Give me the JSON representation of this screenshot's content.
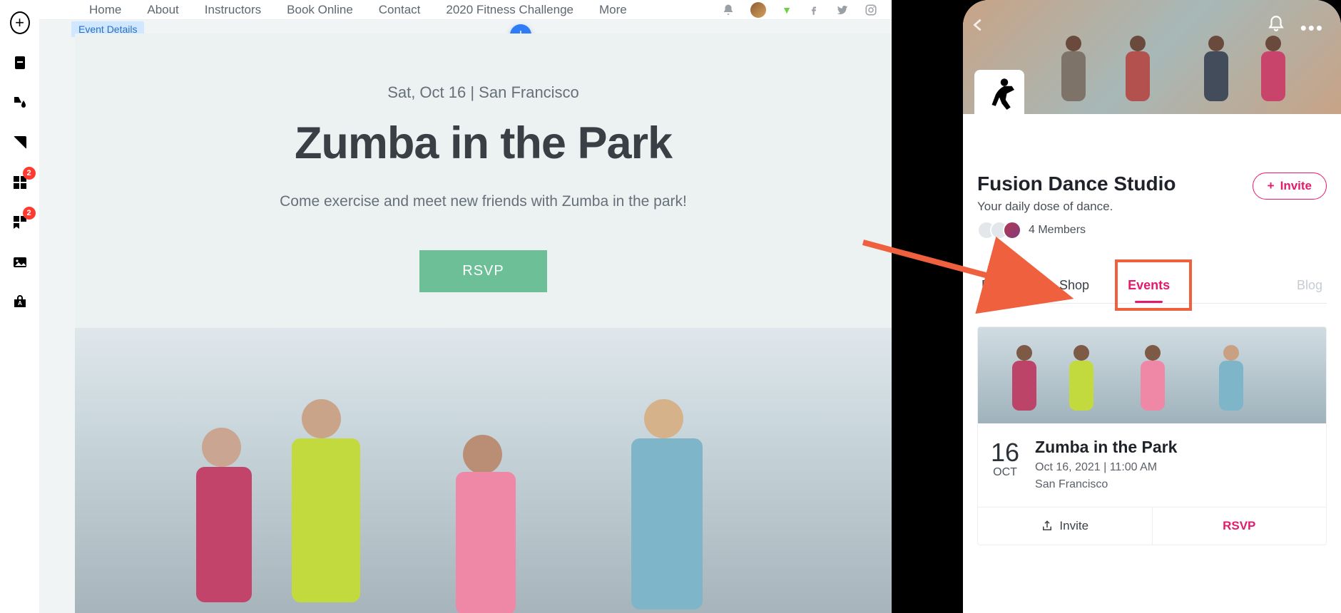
{
  "toolbar": {
    "badges": {
      "elements": "2",
      "sections": "2"
    }
  },
  "nav": {
    "items": [
      "Home",
      "About",
      "Instructors",
      "Book Online",
      "Contact",
      "2020 Fitness Challenge",
      "More"
    ]
  },
  "strip": {
    "label": "Event Details"
  },
  "event": {
    "dateloc": "Sat, Oct 16   |   San Francisco",
    "title": "Zumba in the Park",
    "subtitle": "Come exercise and meet new friends with Zumba in the park!",
    "rsvp": "RSVP"
  },
  "app": {
    "title": "Fusion Dance Studio",
    "tagline": "Your daily dose of dance.",
    "members": "4 Members",
    "invite": "Invite",
    "tabs": [
      "Pricing",
      "Shop",
      "Events",
      "Blog"
    ],
    "card": {
      "day": "16",
      "mon": "OCT",
      "title": "Zumba in the Park",
      "line": "Oct 16, 2021 | 11:00 AM",
      "loc": "San Francisco",
      "invite": "Invite",
      "rsvp": "RSVP"
    }
  }
}
